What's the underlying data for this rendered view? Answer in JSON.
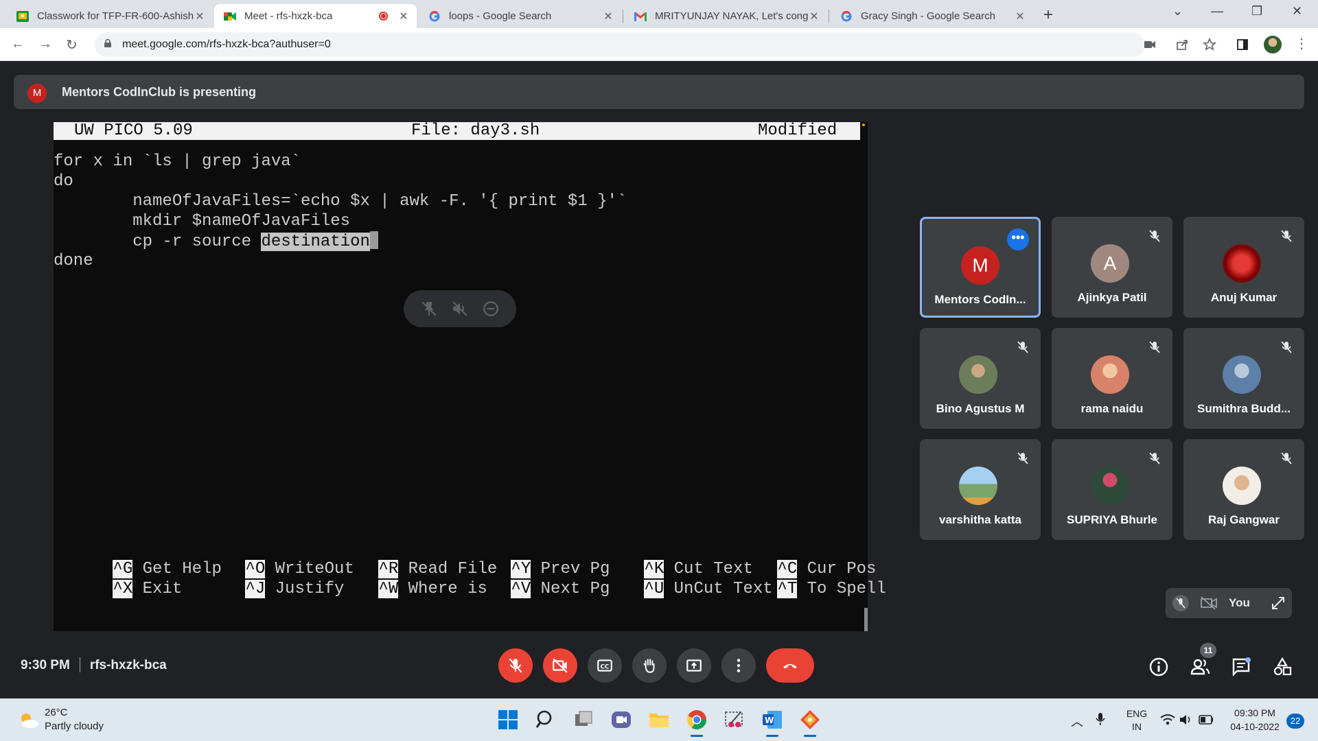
{
  "browser": {
    "tabs": [
      {
        "title": "Classwork for TFP-FR-600-Ashish",
        "icon": "google-classroom-icon"
      },
      {
        "title": "Meet - rfs-hxzk-bca",
        "icon": "google-meet-icon"
      },
      {
        "title": "loops - Google Search",
        "icon": "google-icon"
      },
      {
        "title": "MRITYUNJAY NAYAK, Let's congr",
        "icon": "gmail-icon"
      },
      {
        "title": "Gracy Singh - Google Search",
        "icon": "google-icon"
      }
    ],
    "url": "meet.google.com/rfs-hxzk-bca?authuser=0"
  },
  "meet": {
    "presenter_initial": "M",
    "presenting_text": "Mentors CodInClub is presenting",
    "meeting_time": "9:30 PM",
    "meeting_code": "rfs-hxzk-bca",
    "participant_count": "11",
    "self_label": "You",
    "participants": [
      {
        "name": "Mentors CodIn...",
        "initial": "M",
        "color": "#c5221f",
        "active": true
      },
      {
        "name": "Ajinkya Patil",
        "initial": "A",
        "color": "#a1887f"
      },
      {
        "name": "Anuj Kumar",
        "initial": "",
        "color": "#b71c1c"
      },
      {
        "name": "Bino Agustus M",
        "initial": "",
        "color": "#6d7d5a"
      },
      {
        "name": "rama naidu",
        "initial": "",
        "color": "#d9826a"
      },
      {
        "name": "Sumithra Budd...",
        "initial": "",
        "color": "#5d7fa8"
      },
      {
        "name": "varshitha katta",
        "initial": "",
        "color": "#7aa46a"
      },
      {
        "name": "SUPRIYA Bhurle",
        "initial": "",
        "color": "#2e4a3a"
      },
      {
        "name": "Raj Gangwar",
        "initial": "",
        "color": "#e0cdb8"
      }
    ]
  },
  "terminal": {
    "header_left": "UW PICO 5.09",
    "header_center": "File: day3.sh",
    "header_right": "Modified",
    "line1": "for x in `ls | grep java`",
    "line2": "do",
    "line3": "        nameOfJavaFiles=`echo $x | awk -F. '{ print $1 }'`",
    "line4": "        mkdir $nameOfJavaFiles",
    "line5_prefix": "        cp -r source ",
    "line5_selected": "destination",
    "line6": "done",
    "shortcuts_row1": [
      {
        "key": "^G",
        "label": " Get Help"
      },
      {
        "key": "^O",
        "label": " WriteOut"
      },
      {
        "key": "^R",
        "label": " Read File"
      },
      {
        "key": "^Y",
        "label": " Prev Pg"
      },
      {
        "key": "^K",
        "label": " Cut Text"
      },
      {
        "key": "^C",
        "label": " Cur Pos"
      }
    ],
    "shortcuts_row2": [
      {
        "key": "^X",
        "label": " Exit"
      },
      {
        "key": "^J",
        "label": " Justify"
      },
      {
        "key": "^W",
        "label": " Where is"
      },
      {
        "key": "^V",
        "label": " Next Pg"
      },
      {
        "key": "^U",
        "label": " UnCut Text"
      },
      {
        "key": "^T",
        "label": " To Spell"
      }
    ]
  },
  "taskbar": {
    "temperature": "26°C",
    "weather": "Partly cloudy",
    "lang_top": "ENG",
    "lang_bottom": "IN",
    "time": "09:30 PM",
    "date": "04-10-2022",
    "notifications": "22"
  }
}
